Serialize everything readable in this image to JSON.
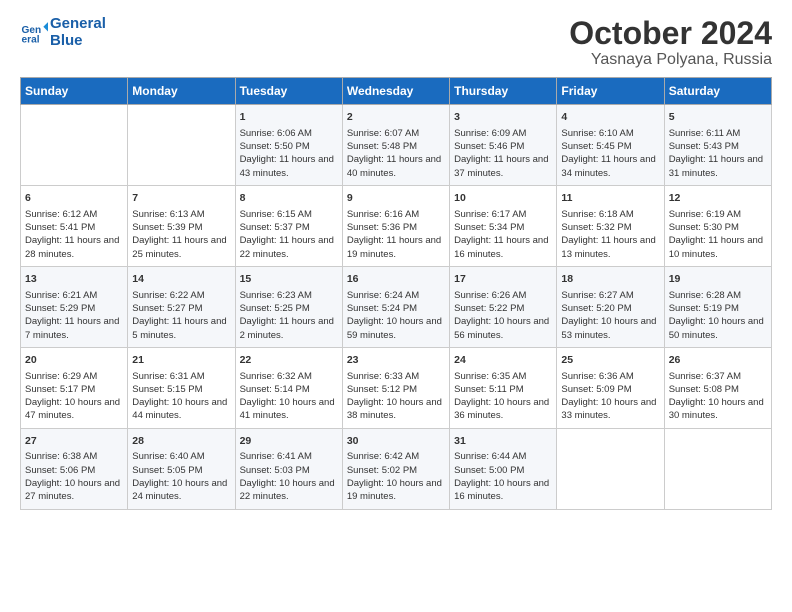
{
  "header": {
    "logo_line1": "General",
    "logo_line2": "Blue",
    "title": "October 2024",
    "subtitle": "Yasnaya Polyana, Russia"
  },
  "days_of_week": [
    "Sunday",
    "Monday",
    "Tuesday",
    "Wednesday",
    "Thursday",
    "Friday",
    "Saturday"
  ],
  "weeks": [
    [
      {
        "day": "",
        "info": ""
      },
      {
        "day": "",
        "info": ""
      },
      {
        "day": "1",
        "info": "Sunrise: 6:06 AM\nSunset: 5:50 PM\nDaylight: 11 hours and 43 minutes."
      },
      {
        "day": "2",
        "info": "Sunrise: 6:07 AM\nSunset: 5:48 PM\nDaylight: 11 hours and 40 minutes."
      },
      {
        "day": "3",
        "info": "Sunrise: 6:09 AM\nSunset: 5:46 PM\nDaylight: 11 hours and 37 minutes."
      },
      {
        "day": "4",
        "info": "Sunrise: 6:10 AM\nSunset: 5:45 PM\nDaylight: 11 hours and 34 minutes."
      },
      {
        "day": "5",
        "info": "Sunrise: 6:11 AM\nSunset: 5:43 PM\nDaylight: 11 hours and 31 minutes."
      }
    ],
    [
      {
        "day": "6",
        "info": "Sunrise: 6:12 AM\nSunset: 5:41 PM\nDaylight: 11 hours and 28 minutes."
      },
      {
        "day": "7",
        "info": "Sunrise: 6:13 AM\nSunset: 5:39 PM\nDaylight: 11 hours and 25 minutes."
      },
      {
        "day": "8",
        "info": "Sunrise: 6:15 AM\nSunset: 5:37 PM\nDaylight: 11 hours and 22 minutes."
      },
      {
        "day": "9",
        "info": "Sunrise: 6:16 AM\nSunset: 5:36 PM\nDaylight: 11 hours and 19 minutes."
      },
      {
        "day": "10",
        "info": "Sunrise: 6:17 AM\nSunset: 5:34 PM\nDaylight: 11 hours and 16 minutes."
      },
      {
        "day": "11",
        "info": "Sunrise: 6:18 AM\nSunset: 5:32 PM\nDaylight: 11 hours and 13 minutes."
      },
      {
        "day": "12",
        "info": "Sunrise: 6:19 AM\nSunset: 5:30 PM\nDaylight: 11 hours and 10 minutes."
      }
    ],
    [
      {
        "day": "13",
        "info": "Sunrise: 6:21 AM\nSunset: 5:29 PM\nDaylight: 11 hours and 7 minutes."
      },
      {
        "day": "14",
        "info": "Sunrise: 6:22 AM\nSunset: 5:27 PM\nDaylight: 11 hours and 5 minutes."
      },
      {
        "day": "15",
        "info": "Sunrise: 6:23 AM\nSunset: 5:25 PM\nDaylight: 11 hours and 2 minutes."
      },
      {
        "day": "16",
        "info": "Sunrise: 6:24 AM\nSunset: 5:24 PM\nDaylight: 10 hours and 59 minutes."
      },
      {
        "day": "17",
        "info": "Sunrise: 6:26 AM\nSunset: 5:22 PM\nDaylight: 10 hours and 56 minutes."
      },
      {
        "day": "18",
        "info": "Sunrise: 6:27 AM\nSunset: 5:20 PM\nDaylight: 10 hours and 53 minutes."
      },
      {
        "day": "19",
        "info": "Sunrise: 6:28 AM\nSunset: 5:19 PM\nDaylight: 10 hours and 50 minutes."
      }
    ],
    [
      {
        "day": "20",
        "info": "Sunrise: 6:29 AM\nSunset: 5:17 PM\nDaylight: 10 hours and 47 minutes."
      },
      {
        "day": "21",
        "info": "Sunrise: 6:31 AM\nSunset: 5:15 PM\nDaylight: 10 hours and 44 minutes."
      },
      {
        "day": "22",
        "info": "Sunrise: 6:32 AM\nSunset: 5:14 PM\nDaylight: 10 hours and 41 minutes."
      },
      {
        "day": "23",
        "info": "Sunrise: 6:33 AM\nSunset: 5:12 PM\nDaylight: 10 hours and 38 minutes."
      },
      {
        "day": "24",
        "info": "Sunrise: 6:35 AM\nSunset: 5:11 PM\nDaylight: 10 hours and 36 minutes."
      },
      {
        "day": "25",
        "info": "Sunrise: 6:36 AM\nSunset: 5:09 PM\nDaylight: 10 hours and 33 minutes."
      },
      {
        "day": "26",
        "info": "Sunrise: 6:37 AM\nSunset: 5:08 PM\nDaylight: 10 hours and 30 minutes."
      }
    ],
    [
      {
        "day": "27",
        "info": "Sunrise: 6:38 AM\nSunset: 5:06 PM\nDaylight: 10 hours and 27 minutes."
      },
      {
        "day": "28",
        "info": "Sunrise: 6:40 AM\nSunset: 5:05 PM\nDaylight: 10 hours and 24 minutes."
      },
      {
        "day": "29",
        "info": "Sunrise: 6:41 AM\nSunset: 5:03 PM\nDaylight: 10 hours and 22 minutes."
      },
      {
        "day": "30",
        "info": "Sunrise: 6:42 AM\nSunset: 5:02 PM\nDaylight: 10 hours and 19 minutes."
      },
      {
        "day": "31",
        "info": "Sunrise: 6:44 AM\nSunset: 5:00 PM\nDaylight: 10 hours and 16 minutes."
      },
      {
        "day": "",
        "info": ""
      },
      {
        "day": "",
        "info": ""
      }
    ]
  ]
}
